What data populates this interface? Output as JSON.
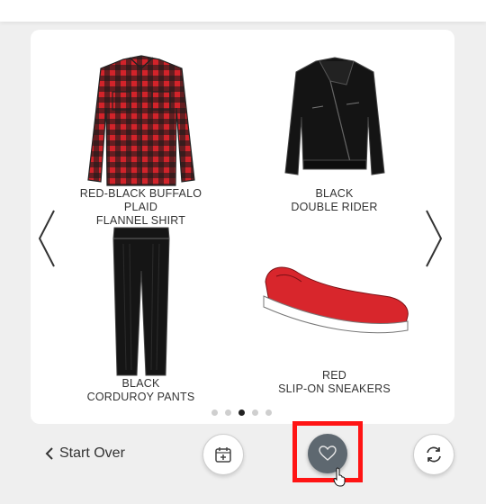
{
  "products": [
    {
      "line1": "RED-BLACK BUFFALO PLAID",
      "line2": "FLANNEL SHIRT",
      "icon": "plaid-shirt-icon"
    },
    {
      "line1": "BLACK",
      "line2": "DOUBLE RIDER",
      "icon": "leather-jacket-icon"
    },
    {
      "line1": "BLACK",
      "line2": "CORDUROY PANTS",
      "icon": "pants-icon"
    },
    {
      "line1": "RED",
      "line2": "SLIP-ON SNEAKERS",
      "icon": "sneaker-icon"
    }
  ],
  "pagination": {
    "total": 5,
    "current": 3
  },
  "footer": {
    "start_over_label": "Start Over",
    "calendar_icon": "calendar-add-icon",
    "favorite_icon": "heart-icon",
    "refresh_icon": "refresh-icon"
  },
  "colors": {
    "background": "#efefef",
    "card": "#ffffff",
    "highlight": "#ff1414",
    "favorite_button": "#5e6870",
    "shirt_red": "#d2232a",
    "sneaker_red": "#d8262c"
  }
}
